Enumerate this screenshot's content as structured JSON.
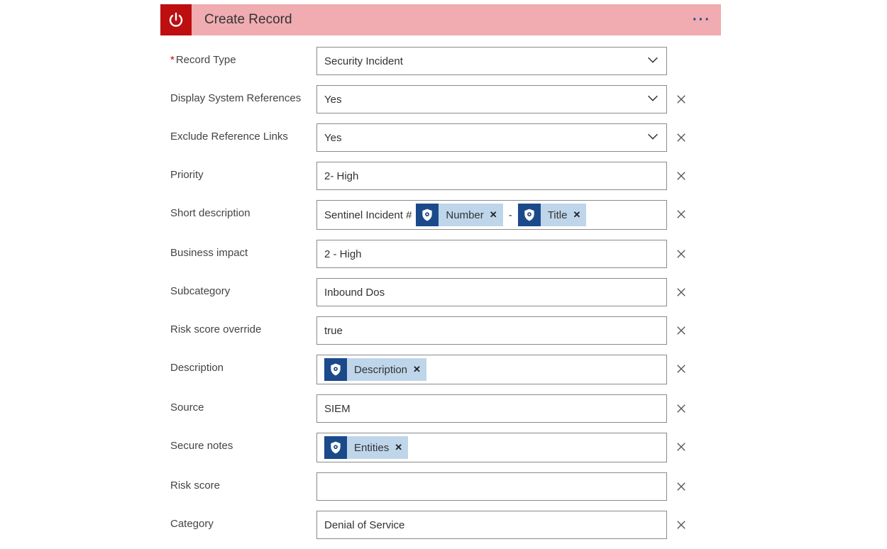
{
  "header": {
    "title": "Create Record",
    "icon_name": "power-icon",
    "more_name": "more-icon"
  },
  "fields": {
    "record_type": {
      "label": "Record Type",
      "required": true,
      "value": "Security Incident",
      "type": "select",
      "clearable": false
    },
    "display_refs": {
      "label": "Display System References",
      "value": "Yes",
      "type": "select",
      "clearable": true
    },
    "exclude_links": {
      "label": "Exclude Reference Links",
      "value": "Yes",
      "type": "select",
      "clearable": true
    },
    "priority": {
      "label": "Priority",
      "value": "2- High",
      "type": "text",
      "clearable": true
    },
    "short_desc": {
      "label": "Short description",
      "prefix": "Sentinel Incident #",
      "sep": " - ",
      "tokens": [
        "Number",
        "Title"
      ],
      "type": "tokens",
      "clearable": true
    },
    "biz_impact": {
      "label": "Business impact",
      "value": "2 - High",
      "type": "text",
      "clearable": true
    },
    "subcategory": {
      "label": "Subcategory",
      "value": "Inbound Dos",
      "type": "text",
      "clearable": true
    },
    "risk_override": {
      "label": "Risk score override",
      "value": "true",
      "type": "text",
      "clearable": true
    },
    "description": {
      "label": "Description",
      "tokens": [
        "Description"
      ],
      "type": "tokens",
      "clearable": true
    },
    "source": {
      "label": "Source",
      "value": "SIEM",
      "type": "text",
      "clearable": true
    },
    "secure_notes": {
      "label": "Secure notes",
      "tokens": [
        "Entities"
      ],
      "type": "tokens",
      "clearable": true
    },
    "risk_score": {
      "label": "Risk score",
      "value": "",
      "type": "text",
      "clearable": true
    },
    "category": {
      "label": "Category",
      "value": "Denial of Service",
      "type": "text",
      "clearable": true
    }
  }
}
